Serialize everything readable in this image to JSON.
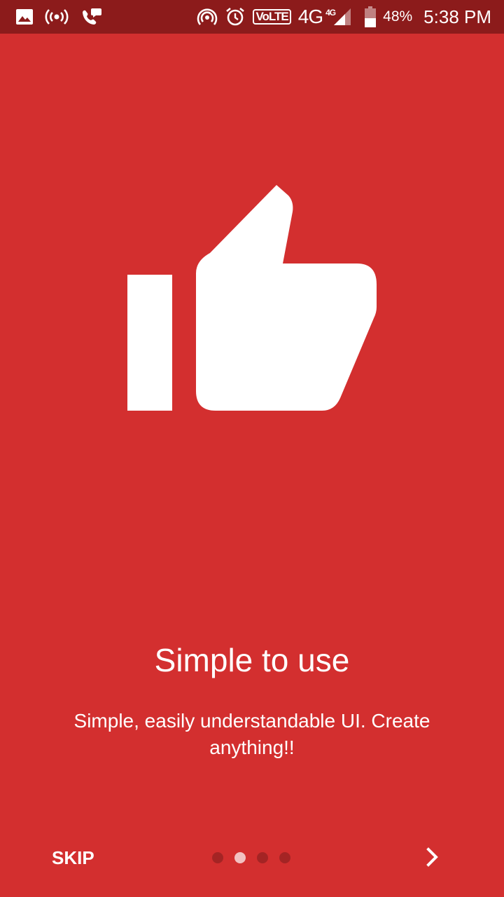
{
  "status_bar": {
    "left_icons": [
      "gallery-icon",
      "hotspot-broadcast-icon",
      "missed-call-icon"
    ],
    "right_icons": [
      "wifi-hotspot-icon",
      "alarm-icon",
      "signal-icon",
      "battery-icon"
    ],
    "volte_label": "VoLTE",
    "network_label": "4G",
    "network_sup": "4G",
    "battery_level": 48,
    "battery_text": "48%",
    "time": "5:38 PM",
    "background_color": "#8c1b1b"
  },
  "onboarding": {
    "background_color": "#d32f2f",
    "hero_icon": "thumbs-up-icon",
    "title": "Simple to use",
    "description": "Simple, easily understandable UI. Create anything!!"
  },
  "navigation": {
    "skip_label": "SKIP",
    "page_count": 4,
    "active_page": 2,
    "next_icon": "chevron-right-icon"
  }
}
